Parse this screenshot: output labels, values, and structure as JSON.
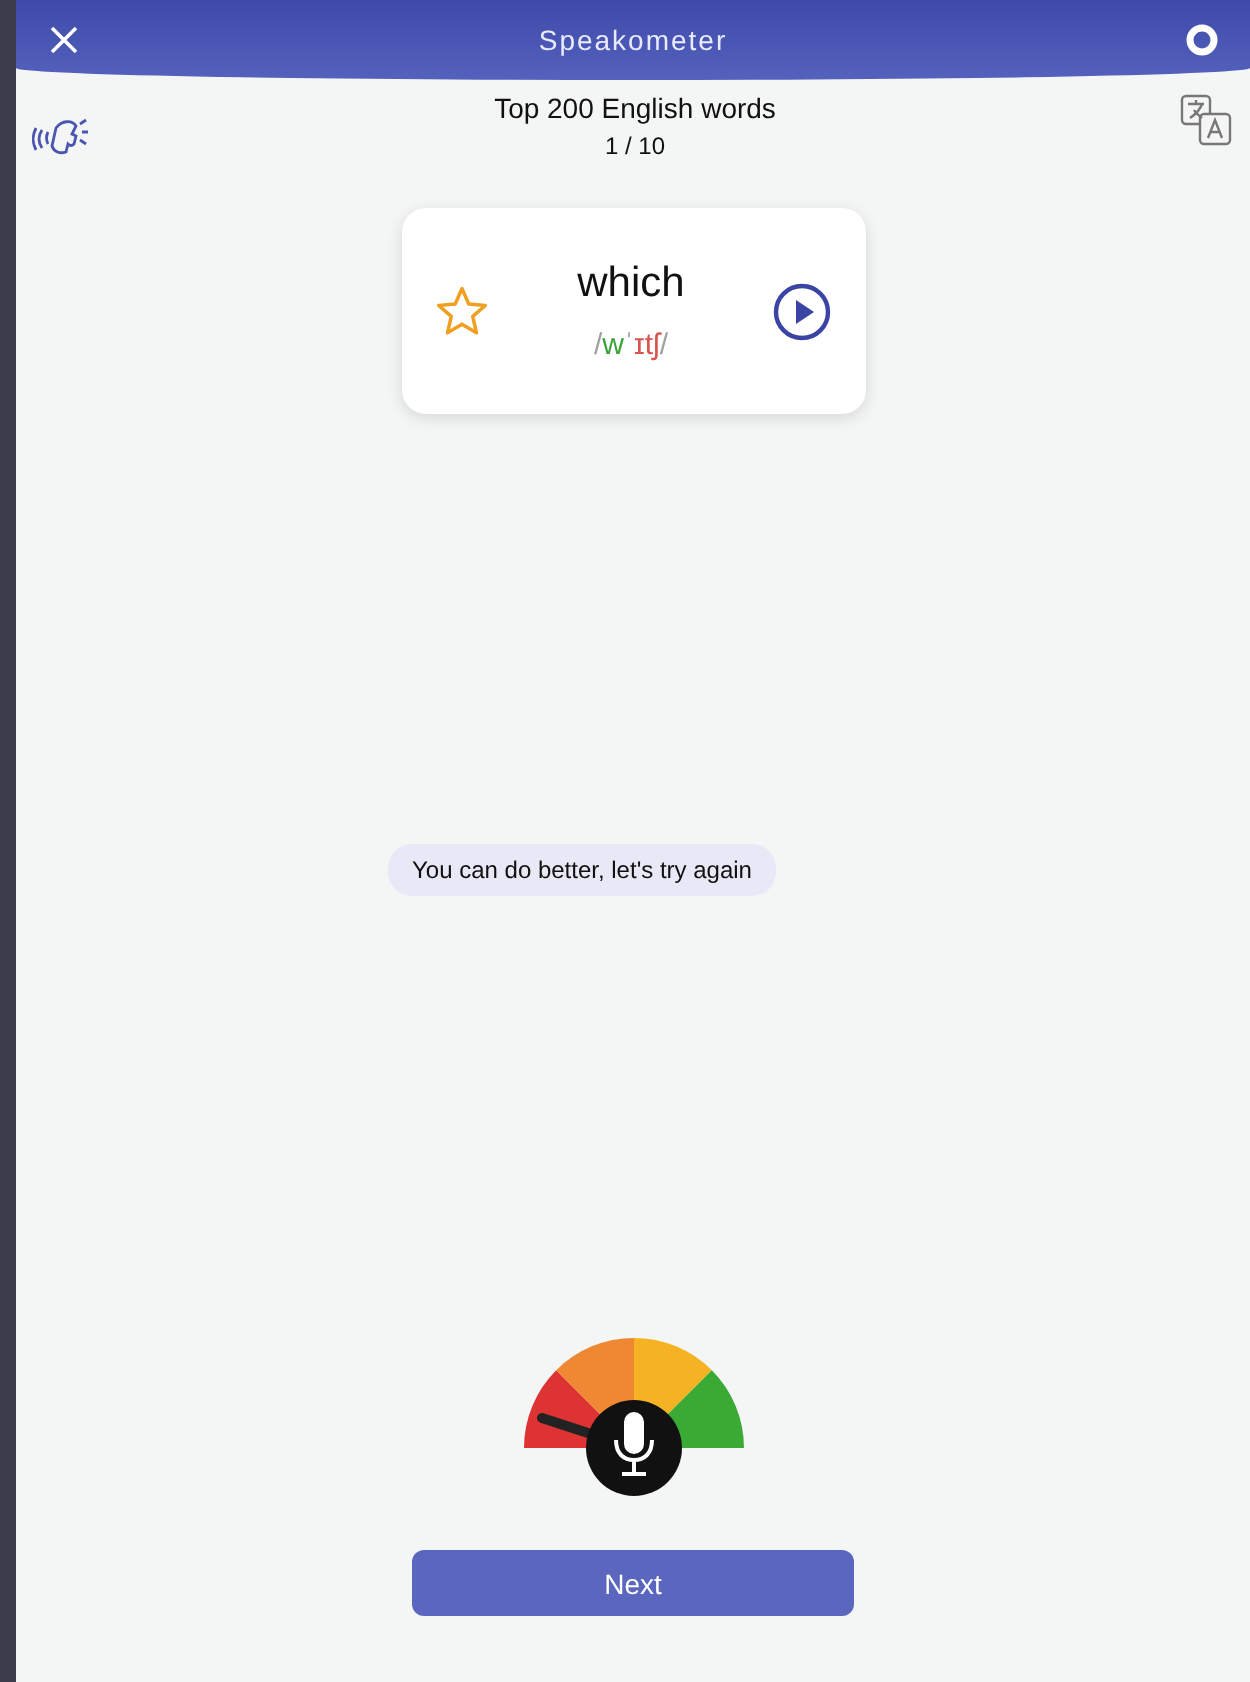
{
  "header": {
    "title": "Speakometer"
  },
  "lesson": {
    "title": "Top 200 English words",
    "progress": "1 / 10"
  },
  "card": {
    "word": "which",
    "favorite": false,
    "phonetic": [
      {
        "text": "/",
        "color": "#a0a0a0"
      },
      {
        "text": "w",
        "color": "#3aa33a"
      },
      {
        "text": "ˈ",
        "color": "#a0a0a0"
      },
      {
        "text": "ɪtʃ",
        "color": "#d9534f"
      },
      {
        "text": "/",
        "color": "#a0a0a0"
      }
    ]
  },
  "feedback": "You can do better, let's try again",
  "next_button": "Next"
}
